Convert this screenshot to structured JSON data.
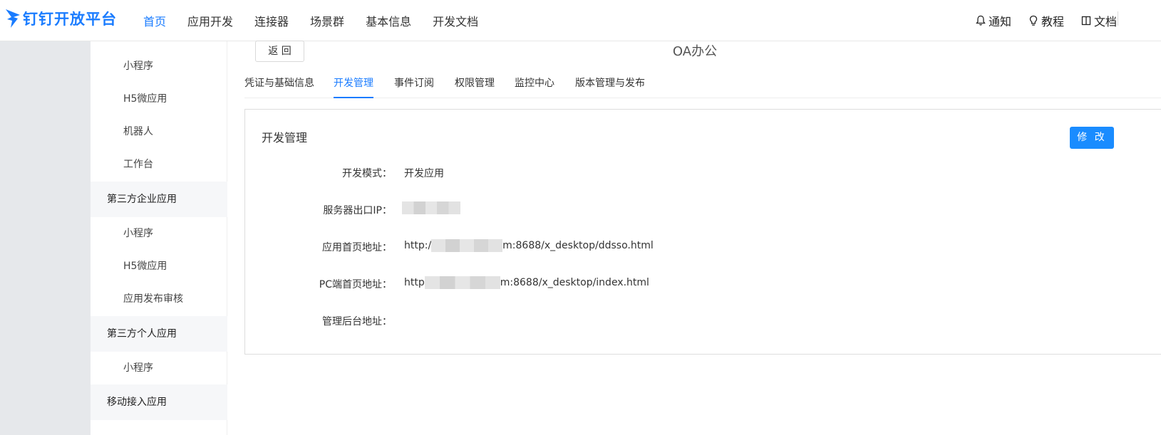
{
  "brand": {
    "name": "钉钉开放平台",
    "color": "#1a7cff"
  },
  "nav": {
    "items": [
      "首页",
      "应用开发",
      "连接器",
      "场景群",
      "基本信息",
      "开发文档"
    ],
    "active": 0
  },
  "top_right": {
    "notify": "通知",
    "tutorial": "教程",
    "docs": "文档"
  },
  "sidebar": {
    "items": [
      {
        "label": "小程序",
        "type": "sub"
      },
      {
        "label": "H5微应用",
        "type": "sub"
      },
      {
        "label": "机器人",
        "type": "sub"
      },
      {
        "label": "工作台",
        "type": "sub"
      },
      {
        "label": "第三方企业应用",
        "type": "group"
      },
      {
        "label": "小程序",
        "type": "sub"
      },
      {
        "label": "H5微应用",
        "type": "sub"
      },
      {
        "label": "应用发布审核",
        "type": "sub"
      },
      {
        "label": "第三方个人应用",
        "type": "group"
      },
      {
        "label": "小程序",
        "type": "sub"
      },
      {
        "label": "移动接入应用",
        "type": "group"
      }
    ]
  },
  "back_button": "返 回",
  "app_title": "OA办公",
  "tabs": {
    "items": [
      "凭证与基础信息",
      "开发管理",
      "事件订阅",
      "权限管理",
      "监控中心",
      "版本管理与发布"
    ],
    "active": 1
  },
  "card": {
    "title": "开发管理",
    "edit_button": "修 改",
    "fields": [
      {
        "label": "开发模式：",
        "value_prefix": "开发应用",
        "value_suffix": ""
      },
      {
        "label": "服务器出口IP：",
        "value_prefix": "",
        "value_suffix": ""
      },
      {
        "label": "应用首页地址：",
        "value_prefix": "http:/",
        "value_suffix": "m:8688/x_desktop/ddsso.html"
      },
      {
        "label": "PC端首页地址：",
        "value_prefix": "http",
        "value_suffix": "m:8688/x_desktop/index.html"
      },
      {
        "label": "管理后台地址：",
        "value_prefix": "",
        "value_suffix": ""
      }
    ]
  }
}
